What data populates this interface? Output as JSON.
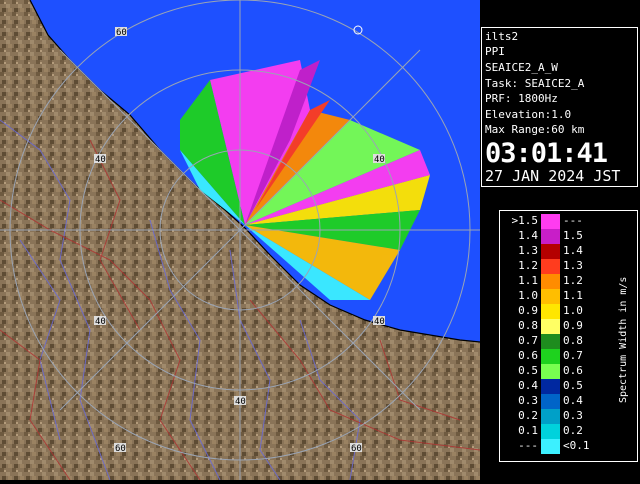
{
  "info": {
    "lines": [
      "ilts2",
      "PPI",
      "SEAICE2_A_W",
      "Task: SEAICE2_A",
      "PRF: 1800Hz",
      "Elevation:1.0",
      "Max Range:60 km"
    ],
    "time": "03:01:41",
    "date": "27 JAN 2024 JST"
  },
  "legend": {
    "title": "Spectrum Width in m/s",
    "rows": [
      {
        "left": ">1.5",
        "right": "---",
        "color": "#ff3cf0"
      },
      {
        "left": "1.4",
        "right": "1.5",
        "color": "#c81ec8"
      },
      {
        "left": "1.3",
        "right": "1.4",
        "color": "#b40000"
      },
      {
        "left": "1.2",
        "right": "1.3",
        "color": "#ff3c1e"
      },
      {
        "left": "1.1",
        "right": "1.2",
        "color": "#ff8c00"
      },
      {
        "left": "1.0",
        "right": "1.1",
        "color": "#ffbe00"
      },
      {
        "left": "0.9",
        "right": "1.0",
        "color": "#ffe600"
      },
      {
        "left": "0.8",
        "right": "0.9",
        "color": "#ffff64"
      },
      {
        "left": "0.7",
        "right": "0.8",
        "color": "#1e8c1e"
      },
      {
        "left": "0.6",
        "right": "0.7",
        "color": "#1ed21e"
      },
      {
        "left": "0.5",
        "right": "0.6",
        "color": "#78ff50"
      },
      {
        "left": "0.4",
        "right": "0.5",
        "color": "#0028a0"
      },
      {
        "left": "0.3",
        "right": "0.4",
        "color": "#0064c8"
      },
      {
        "left": "0.2",
        "right": "0.3",
        "color": "#00a0c8"
      },
      {
        "left": "0.1",
        "right": "0.2",
        "color": "#00d2dc"
      },
      {
        "left": "---",
        "right": "<0.1",
        "color": "#3cf0ff"
      }
    ]
  },
  "map": {
    "sea_color": "#1e50ff",
    "land_color": "#8a7458",
    "ring_labels": [
      "60",
      "40",
      "40",
      "40",
      "40",
      "40",
      "60",
      "60"
    ]
  }
}
